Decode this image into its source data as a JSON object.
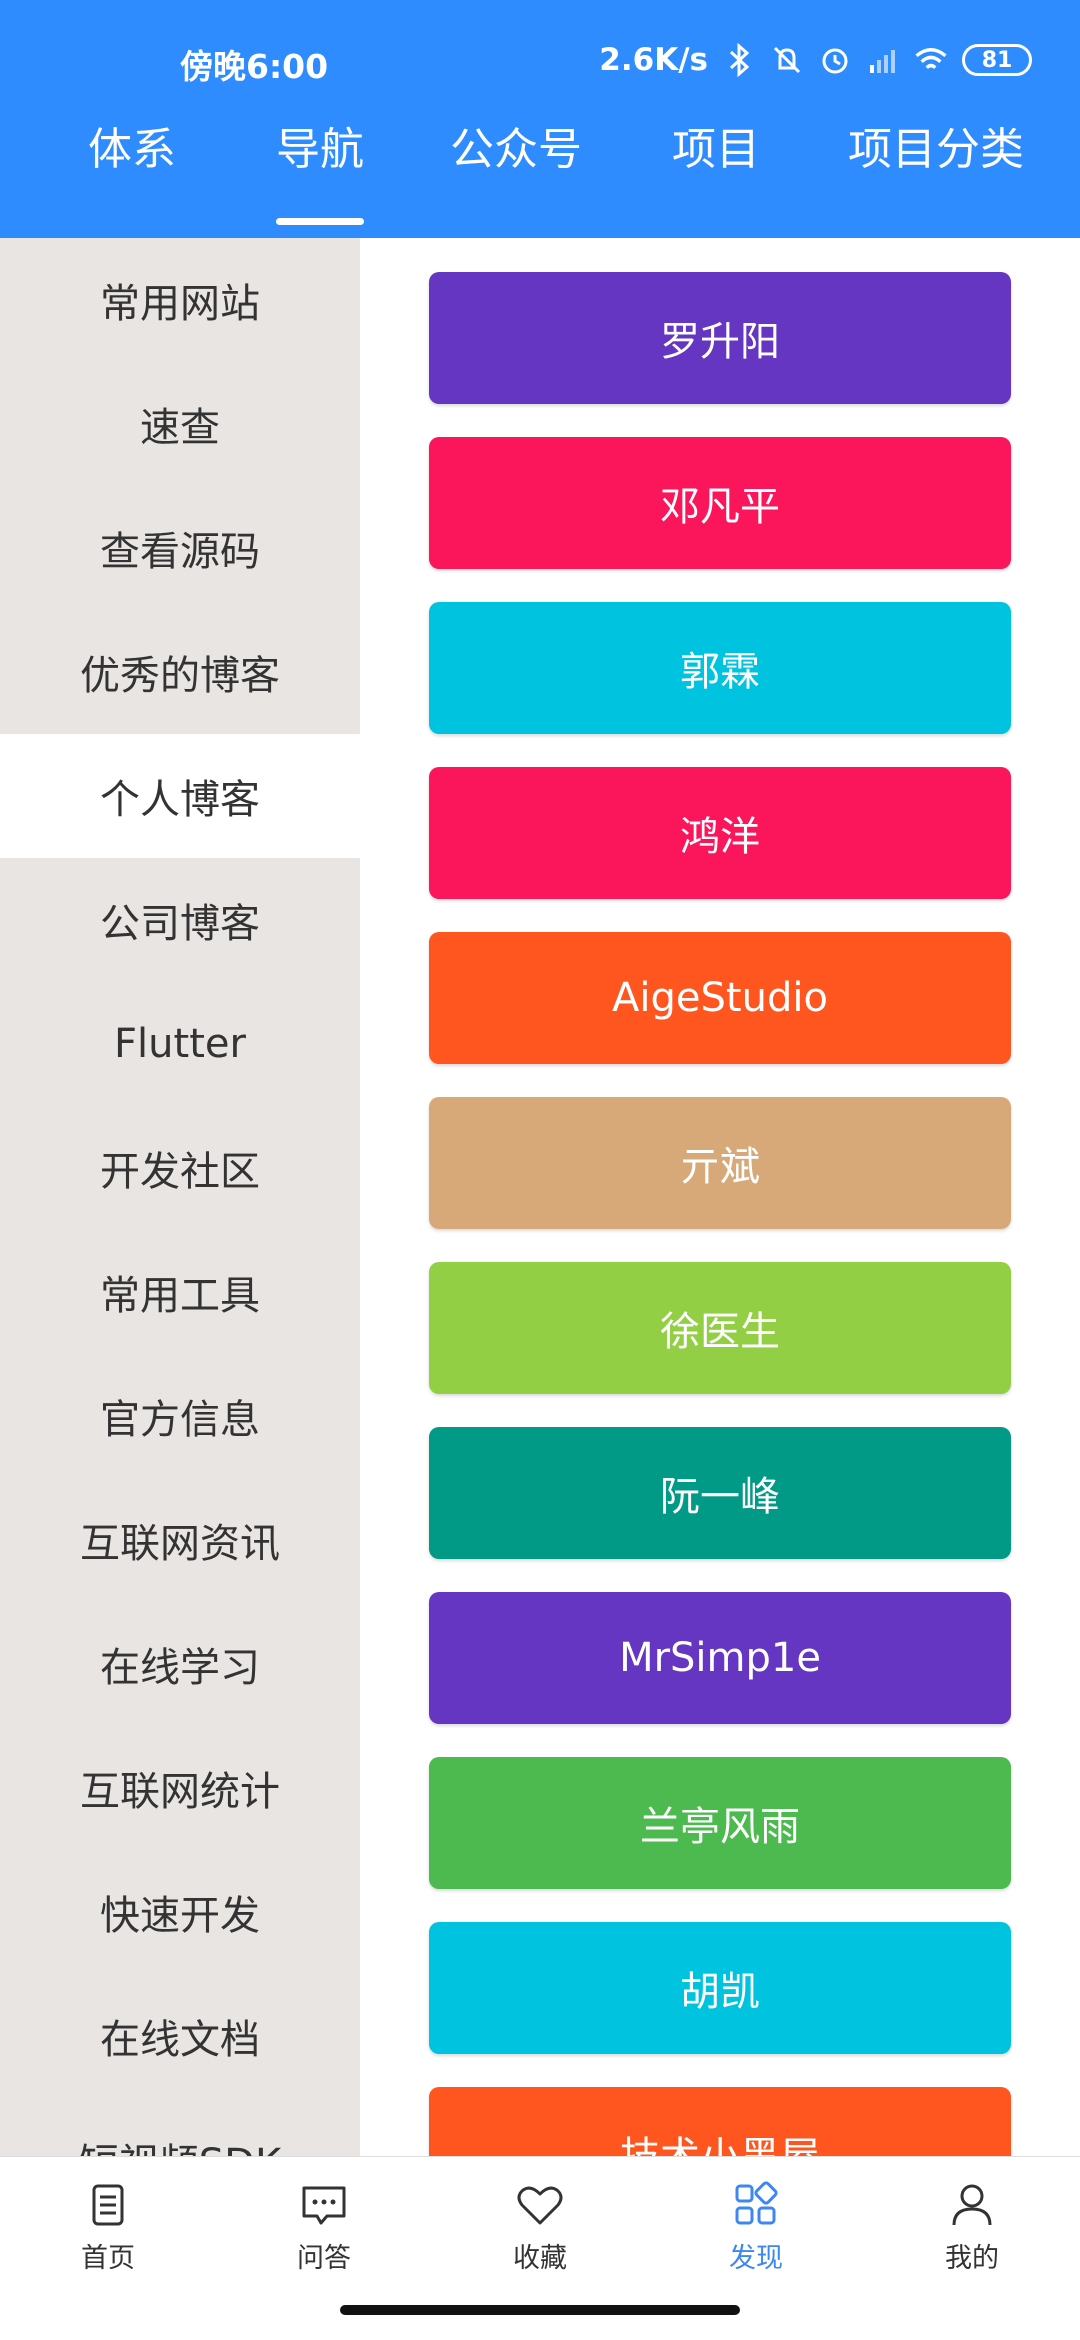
{
  "status": {
    "time": "傍晚6:00",
    "speed": "2.6K/s",
    "battery": "81"
  },
  "top_tabs": [
    {
      "label": "体系"
    },
    {
      "label": "导航"
    },
    {
      "label": "公众号"
    },
    {
      "label": "项目"
    },
    {
      "label": "项目分类"
    }
  ],
  "sidebar": {
    "items": [
      {
        "label": "常用网站"
      },
      {
        "label": "速查"
      },
      {
        "label": "查看源码"
      },
      {
        "label": "优秀的博客"
      },
      {
        "label": "个人博客"
      },
      {
        "label": "公司博客"
      },
      {
        "label": "Flutter"
      },
      {
        "label": "开发社区"
      },
      {
        "label": "常用工具"
      },
      {
        "label": "官方信息"
      },
      {
        "label": "互联网资讯"
      },
      {
        "label": "在线学习"
      },
      {
        "label": "互联网统计"
      },
      {
        "label": "快速开发"
      },
      {
        "label": "在线文档"
      },
      {
        "label": "短视频SDK"
      }
    ]
  },
  "chips": [
    {
      "label": "罗升阳",
      "color": "#6536c1"
    },
    {
      "label": "邓凡平",
      "color": "#fb165c"
    },
    {
      "label": "郭霖",
      "color": "#00c4df"
    },
    {
      "label": "鸿洋",
      "color": "#fb165c"
    },
    {
      "label": "AigeStudio",
      "color": "#ff5620"
    },
    {
      "label": "亓斌",
      "color": "#d7a979"
    },
    {
      "label": "徐医生",
      "color": "#92cf44"
    },
    {
      "label": "阮一峰",
      "color": "#009a87"
    },
    {
      "label": "MrSimp1e",
      "color": "#6536c1"
    },
    {
      "label": "兰亭风雨",
      "color": "#4cba4f"
    },
    {
      "label": "胡凯",
      "color": "#00c4df"
    },
    {
      "label": "技术小黑屋",
      "color": "#ff5620"
    }
  ],
  "bottom_nav": [
    {
      "label": "首页",
      "icon": "home-doc-icon"
    },
    {
      "label": "问答",
      "icon": "chat-icon"
    },
    {
      "label": "收藏",
      "icon": "heart-icon"
    },
    {
      "label": "发现",
      "icon": "grid-icon"
    },
    {
      "label": "我的",
      "icon": "person-icon"
    }
  ],
  "colors": {
    "header": "#2f8cff",
    "sidebar_bg": "#e8e5e3",
    "active_nav": "#3d86f5"
  },
  "state": {
    "active_top_tab": 1,
    "active_sidebar_item": 4,
    "active_bottom_nav": 3
  }
}
